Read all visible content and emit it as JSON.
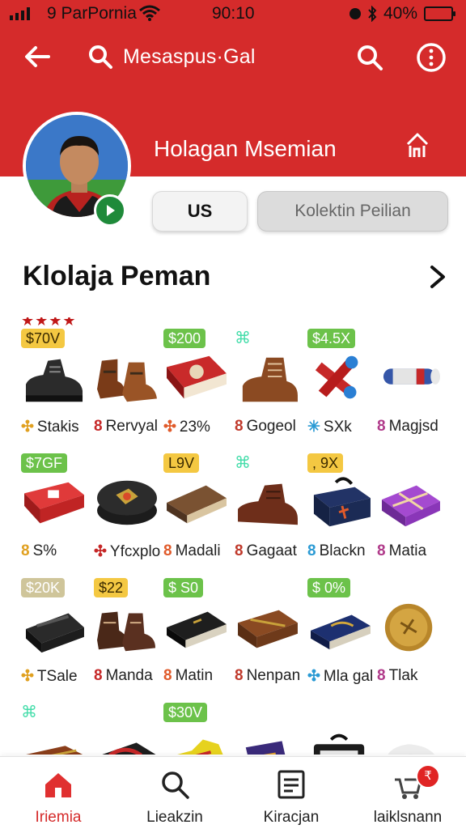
{
  "status_bar": {
    "carrier": "9 ParPornia",
    "time": "90:10",
    "battery": "40%",
    "battery_level": 0.9
  },
  "header": {
    "search_title": "Mesaspus·Gal",
    "profile_name": "Holagan  Msemian",
    "icons": [
      "back-arrow-icon",
      "search-icon",
      "search-icon",
      "more-vertical-icon",
      "share-icon",
      "play-icon"
    ],
    "colors": {
      "brand_red": "#d52b2b",
      "play_badge": "#1f8a3a"
    }
  },
  "profile_buttons": {
    "primary": "US",
    "secondary": "Kolektin Peilian"
  },
  "section": {
    "title": "Klolaja Peman",
    "chevron": "chevron-right-icon"
  },
  "items": [
    {
      "tag": "$70V",
      "tag_style": "yellow",
      "stars": "★★★★",
      "lead": "✣",
      "label": "Stakis",
      "art": "boot-black"
    },
    {
      "tag": "",
      "tag_style": "none",
      "lead": "8",
      "label": "Rervyal",
      "art": "boots-brown-pair"
    },
    {
      "tag": "$200",
      "tag_style": "green",
      "lead": "✣",
      "label": "23%",
      "art": "book-red"
    },
    {
      "tag": "⌘",
      "tag_style": "plain",
      "lead": "8",
      "label": "Gogeol",
      "art": "boot-brown"
    },
    {
      "tag": "$4.5X",
      "tag_style": "green",
      "lead": "✳",
      "label": "SXk",
      "art": "scrolls-red"
    },
    {
      "tag": "",
      "tag_style": "none",
      "lead": "8",
      "label": "Magjsd",
      "art": "scroll-tube"
    },
    {
      "tag": "$7GF",
      "tag_style": "green",
      "lead": "8",
      "label": "S%",
      "art": "box-red"
    },
    {
      "tag": "",
      "tag_style": "none",
      "lead": "✣",
      "label": "Yfcxplo",
      "art": "tin-round"
    },
    {
      "tag": "L9V",
      "tag_style": "yellow",
      "lead": "8",
      "label": "Madali",
      "art": "book-brown"
    },
    {
      "tag": "⌘",
      "tag_style": "plain",
      "lead": "8",
      "label": "Gagaat",
      "art": "shoe-brown"
    },
    {
      "tag": ", 9X",
      "tag_style": "yellow",
      "lead": "8",
      "label": "Blackn",
      "art": "bag-navy"
    },
    {
      "tag": "",
      "tag_style": "none",
      "lead": "8",
      "label": "Matia",
      "art": "gift-purple"
    },
    {
      "tag": "$20K",
      "tag_style": "faded",
      "lead": "✣",
      "label": "TSale",
      "art": "device-black"
    },
    {
      "tag": "$22",
      "tag_style": "yellow",
      "lead": "8",
      "label": "Manda",
      "art": "boots-dark-pair"
    },
    {
      "tag": "$ S0",
      "tag_style": "green",
      "lead": "8",
      "label": "Matin",
      "art": "book-black"
    },
    {
      "tag": "",
      "tag_style": "none",
      "lead": "8",
      "label": "Nenpan",
      "art": "chest-brown"
    },
    {
      "tag": "$ 0%",
      "tag_style": "green",
      "lead": "✣",
      "label": "Mla gal",
      "art": "book-navy"
    },
    {
      "tag": "",
      "tag_style": "none",
      "lead": "8",
      "label": "Tlak",
      "art": "coin-gold"
    },
    {
      "tag": "⌘",
      "tag_style": "plain",
      "lead": "",
      "label": "",
      "art": "chest-wood"
    },
    {
      "tag": "",
      "tag_style": "none",
      "lead": "",
      "label": "",
      "art": "bag-red"
    },
    {
      "tag": "$30V",
      "tag_style": "green",
      "lead": "",
      "label": "",
      "art": "sneaker-yellow"
    },
    {
      "tag": "",
      "tag_style": "none",
      "lead": "",
      "label": "",
      "art": "card-purple"
    },
    {
      "tag": "",
      "tag_style": "none",
      "lead": "",
      "label": "",
      "art": "case-black"
    },
    {
      "tag": "",
      "tag_style": "none",
      "lead": "",
      "label": "",
      "art": "pillow-white"
    }
  ],
  "bottom_nav": [
    {
      "label": "Iriemia",
      "icon": "home-icon",
      "active": true
    },
    {
      "label": "Lieakzin",
      "icon": "search-icon",
      "active": false
    },
    {
      "label": "Kiracjan",
      "icon": "list-icon",
      "active": false
    },
    {
      "label": "laiklsnann",
      "icon": "cart-icon",
      "active": false,
      "badge": "₹"
    }
  ]
}
